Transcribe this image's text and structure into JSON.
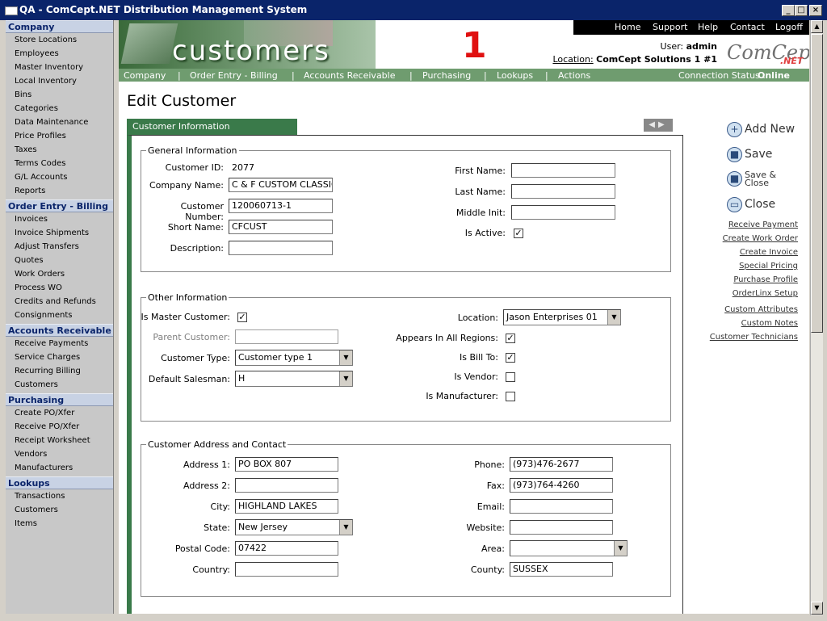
{
  "window": {
    "title": "QA - ComCept.NET Distribution Management System"
  },
  "sidebar": {
    "sections": [
      {
        "title": "Company",
        "items": [
          "Store Locations",
          "Employees",
          "Master Inventory",
          "Local Inventory",
          "Bins",
          "Categories",
          "Data Maintenance",
          "Price Profiles",
          "Taxes",
          "Terms Codes",
          "G/L Accounts",
          "Reports"
        ]
      },
      {
        "title": "Order Entry - Billing",
        "items": [
          "Invoices",
          "Invoice Shipments",
          "Adjust Transfers",
          "Quotes",
          "Work Orders",
          "Process WO",
          "Credits and Refunds",
          "Consignments"
        ]
      },
      {
        "title": "Accounts Receivable",
        "items": [
          "Receive Payments",
          "Service Charges",
          "Recurring Billing",
          "Customers"
        ]
      },
      {
        "title": "Purchasing",
        "items": [
          "Create PO/Xfer",
          "Receive PO/Xfer",
          "Receipt Worksheet",
          "Vendors",
          "Manufacturers"
        ]
      },
      {
        "title": "Lookups",
        "items": [
          "Transactions",
          "Customers",
          "Items"
        ]
      }
    ]
  },
  "header": {
    "banner_word": "customers",
    "big_number": "1",
    "top_nav": [
      "Home",
      "Support",
      "Help",
      "Contact",
      "Logoff"
    ],
    "user_label": "User:",
    "user": "admin",
    "location_label": "Location:",
    "location": "ComCept Solutions 1 #1",
    "logo": "ComCept",
    "logo_sub": ".NET",
    "main_nav": [
      "Company",
      "Order Entry - Billing",
      "Accounts Receivable",
      "Purchasing",
      "Lookups",
      "Actions"
    ],
    "status_label": "Connection Status :",
    "status": "Online"
  },
  "page": {
    "title": "Edit Customer",
    "tab": "Customer Information"
  },
  "general": {
    "legend": "General Information",
    "customer_id_label": "Customer ID:",
    "customer_id": "2077",
    "company_name_label": "Company Name:",
    "company_name": "C & F CUSTOM CLASSIC C",
    "customer_number_label": "Customer Number:",
    "customer_number": "120060713-1",
    "short_name_label": "Short Name:",
    "short_name": "CFCUST",
    "description_label": "Description:",
    "description": "",
    "first_name_label": "First Name:",
    "first_name": "",
    "last_name_label": "Last Name:",
    "last_name": "",
    "middle_init_label": "Middle Init:",
    "middle_init": "",
    "is_active_label": "Is Active:",
    "is_active": "✓"
  },
  "other": {
    "legend": "Other Information",
    "is_master_label": "Is Master Customer:",
    "is_master": "✓",
    "parent_label": "Parent Customer:",
    "parent": "",
    "type_label": "Customer Type:",
    "type": "Customer type 1",
    "salesman_label": "Default Salesman:",
    "salesman": "H",
    "location_label": "Location:",
    "location": "Jason Enterprises 01",
    "all_regions_label": "Appears In All Regions:",
    "all_regions": "✓",
    "bill_to_label": "Is Bill To:",
    "bill_to": "✓",
    "vendor_label": "Is Vendor:",
    "vendor": "",
    "manufacturer_label": "Is Manufacturer:",
    "manufacturer": ""
  },
  "address": {
    "legend": "Customer Address and Contact",
    "addr1_label": "Address 1:",
    "addr1": "PO BOX 807",
    "addr2_label": "Address 2:",
    "addr2": "",
    "city_label": "City:",
    "city": "HIGHLAND LAKES",
    "state_label": "State:",
    "state": "New Jersey",
    "postal_label": "Postal Code:",
    "postal": "07422",
    "country_label": "Country:",
    "country": "",
    "phone_label": "Phone:",
    "phone": "(973)476-2677",
    "fax_label": "Fax:",
    "fax": "(973)764-4260",
    "email_label": "Email:",
    "email": "",
    "website_label": "Website:",
    "website": "",
    "area_label": "Area:",
    "area": "",
    "county_label": "County:",
    "county": "SUSSEX"
  },
  "actions": {
    "add": "Add New",
    "save": "Save",
    "save_close_1": "Save &",
    "save_close_2": "Close",
    "close": "Close",
    "links": [
      "Receive Payment",
      "Create Work Order",
      "Create Invoice",
      "Special Pricing",
      "Purchase Profile",
      "OrderLinx Setup",
      "Custom Attributes",
      "Custom Notes",
      "Customer Technicians"
    ]
  }
}
